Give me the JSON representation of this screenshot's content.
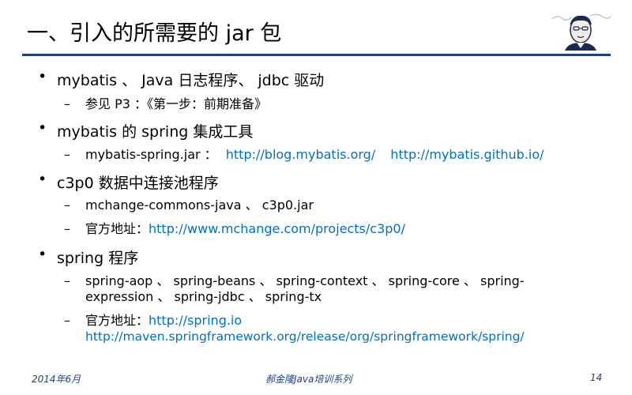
{
  "slide": {
    "title": "一、引入的所需要的 jar 包",
    "bullets": [
      {
        "text": "mybatis 、 Java 日志程序、 jdbc 驱动",
        "subs": [
          {
            "text": "参见 P3 ：《第一步：前期准备》"
          }
        ]
      },
      {
        "text": "mybatis 的 spring 集成工具",
        "subs": [
          {
            "prefix": "mybatis-spring.jar ：",
            "link1": "http://blog.mybatis.org/",
            "link2": "http://mybatis.github.io/"
          }
        ]
      },
      {
        "text": "c3p0 数据中连接池程序",
        "subs": [
          {
            "text": "mchange-commons-java 、 c3p0.jar"
          },
          {
            "prefix": "官方地址：",
            "link1": "http://www.mchange.com/projects/c3p0/"
          }
        ]
      },
      {
        "text": "spring 程序",
        "subs": [
          {
            "line1": "spring-aop 、 spring-beans 、 spring-context 、 spring-core 、 spring-",
            "line2": "expression 、 spring-jdbc 、 spring-tx"
          },
          {
            "prefix": "官方地址：",
            "link1": "http://spring.io",
            "link2": "http://maven.springframework.org/release/org/springframework/spring/"
          }
        ]
      }
    ],
    "bullet_symbol": "•",
    "sub_bullet_symbol": "–"
  },
  "footer": {
    "date": "2014年6月",
    "center": "郝金隆Java培训系列",
    "page": "14"
  },
  "colors": {
    "title_rule": "#1f3f7f",
    "link": "#0070c0",
    "footer": "#1f3f7f"
  },
  "icons": {
    "avatar": "presenter-portrait"
  }
}
